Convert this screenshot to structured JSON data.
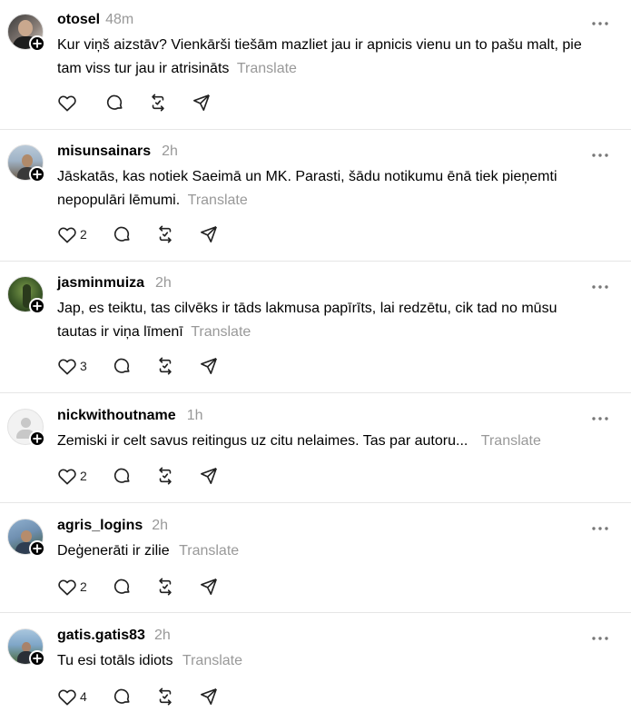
{
  "posts": [
    {
      "username": "otosel",
      "time": "48m",
      "text": "Kur viņš aizstāv? Vienkārši tiešām mazliet jau ir apnicis vienu un to pašu malt, pie tam viss tur jau ir atrisināts",
      "translate": "Translate",
      "likes": "",
      "avatar_colors": [
        "#2b2b2b",
        "#8a7f78"
      ]
    },
    {
      "username": "misunsainars",
      "time": "2h",
      "text": "Jāskatās, kas notiek Saeimā un MK. Parasti, šādu notikumu ēnā tiek pieņemti nepopulāri lēmumi.",
      "translate": "Translate",
      "likes": "2",
      "avatar_colors": [
        "#9fb3c6",
        "#6b5a46"
      ]
    },
    {
      "username": "jasminmuiza",
      "time": "2h",
      "text": "Jap, es teiktu, tas cilvēks ir tāds lakmusa papīrīts, lai redzētu, cik tad no mūsu tautas ir viņa līmenī",
      "translate": "Translate",
      "likes": "3",
      "avatar_colors": [
        "#2f4a22",
        "#7a9a4a"
      ]
    },
    {
      "username": "nickwithoutname",
      "time": "1h",
      "text": "Zemiski ir celt savus reitingus uz citu nelaimes. Tas par autoru...",
      "translate": "Translate",
      "likes": "2",
      "avatar_colors": [
        "#f0f0f0",
        "#c8c8c8"
      ]
    },
    {
      "username": "agris_logins",
      "time": "2h",
      "text": "Deģenerāti ir zilie",
      "translate": "Translate",
      "likes": "2",
      "avatar_colors": [
        "#6f8fb0",
        "#3d5a3a"
      ]
    },
    {
      "username": "gatis.gatis83",
      "time": "2h",
      "text": "Tu esi totāls idiots",
      "translate": "Translate",
      "likes": "4",
      "avatar_colors": [
        "#7fa6c8",
        "#4c6b3a"
      ]
    }
  ],
  "icons": {
    "like": "heart-icon",
    "reply": "comment-icon",
    "repost": "repost-icon",
    "share": "send-icon",
    "more": "more-horizontal-icon",
    "follow": "plus-icon"
  }
}
